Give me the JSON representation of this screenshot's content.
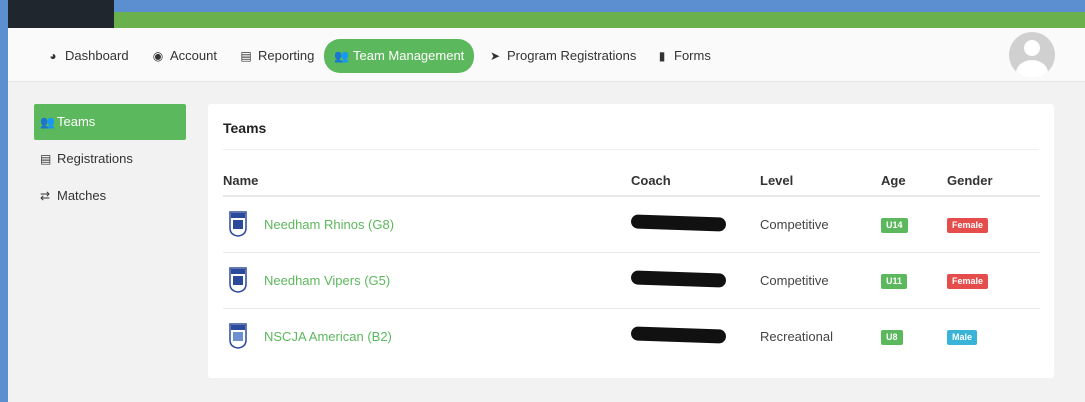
{
  "colors": {
    "accent_green": "#5cb85c",
    "female": "#e54d4d",
    "male": "#39b3d7",
    "top_bar_green": "#6ab04c"
  },
  "nav": {
    "items": [
      {
        "label": "Dashboard",
        "icon": "dashboard-icon"
      },
      {
        "label": "Account",
        "icon": "user-circle-icon"
      },
      {
        "label": "Reporting",
        "icon": "document-icon"
      },
      {
        "label": "Team Management",
        "icon": "users-icon",
        "active": true
      },
      {
        "label": "Program Registrations",
        "icon": "paper-plane-icon"
      },
      {
        "label": "Forms",
        "icon": "file-icon"
      }
    ]
  },
  "sidebar": {
    "items": [
      {
        "label": "Teams",
        "icon": "users-icon",
        "active": true
      },
      {
        "label": "Registrations",
        "icon": "list-icon"
      },
      {
        "label": "Matches",
        "icon": "exchange-icon"
      }
    ]
  },
  "teams": {
    "title": "Teams",
    "columns": [
      "Name",
      "Coach",
      "Level",
      "Age",
      "Gender"
    ],
    "rows": [
      {
        "name": "Needham Rhinos (G8)",
        "coach": "",
        "level": "Competitive",
        "age": "U14",
        "gender": "Female"
      },
      {
        "name": "Needham Vipers (G5)",
        "coach": "",
        "level": "Competitive",
        "age": "U11",
        "gender": "Female"
      },
      {
        "name": "NSCJA American (B2)",
        "coach": "",
        "level": "Recreational",
        "age": "U8",
        "gender": "Male"
      }
    ]
  }
}
